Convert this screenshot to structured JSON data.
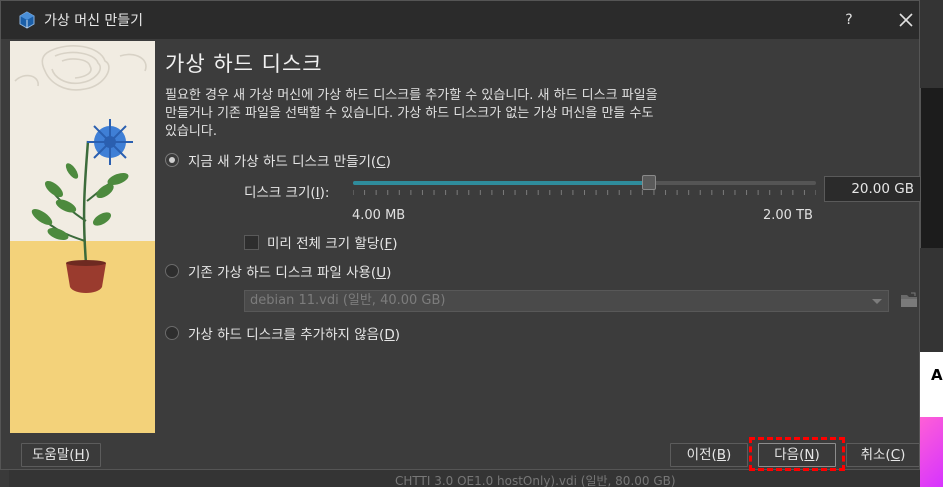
{
  "window": {
    "title": "가상 머신 만들기",
    "help_label": "?"
  },
  "page": {
    "heading": "가상 하드 디스크",
    "description_lines": [
      "필요한 경우 새 가상 머신에 가상 하드 디스크를 추가할 수 있습니다. 새 하드 디스크 파일을",
      "만들거나 기존 파일을 선택할 수 있습니다. 가상 하드 디스크가 없는 가상 머신을 만들 수도",
      "있습니다."
    ]
  },
  "options": {
    "create_new": {
      "label": "지금 새 가상 하드 디스크 만들기(",
      "mnemonic": "C",
      "suffix": ")",
      "checked": true
    },
    "existing": {
      "label": "기존 가상 하드 디스크 파일 사용(",
      "mnemonic": "U",
      "suffix": ")",
      "checked": false
    },
    "none": {
      "label": "가상 하드 디스크를 추가하지 않음(",
      "mnemonic": "D",
      "suffix": ")",
      "checked": false
    }
  },
  "disk_size": {
    "label_prefix": "디스크 크기(",
    "label_mnemonic": "I",
    "label_suffix": "):",
    "value": "20.00 GB",
    "min_label": "4.00 MB",
    "max_label": "2.00 TB",
    "slider_fraction": 0.64
  },
  "preallocate": {
    "label": "미리 전체 크기 할당(",
    "mnemonic": "F",
    "suffix": ")",
    "checked": false
  },
  "existing_file": {
    "selected": "debian 11.vdi (일반, 40.00 GB)"
  },
  "buttons": {
    "help": {
      "label": "도움말(",
      "mnemonic": "H",
      "suffix": ")"
    },
    "back": {
      "label": "이전(",
      "mnemonic": "B",
      "suffix": ")"
    },
    "next": {
      "label": "다음(",
      "mnemonic": "N",
      "suffix": ")"
    },
    "cancel": {
      "label": "취소(",
      "mnemonic": "C",
      "suffix": ")"
    }
  },
  "background": {
    "right_letter": "A",
    "bottom_text": "CHTTI 3.0      OE1.0 hostOnly).vdi (일반, 80.00 GB)"
  },
  "colors": {
    "accent": "#2f8c9c",
    "highlight": "#ff0000",
    "dialog_bg": "#3c3c3c",
    "titlebar_bg": "#2b2b2b"
  }
}
